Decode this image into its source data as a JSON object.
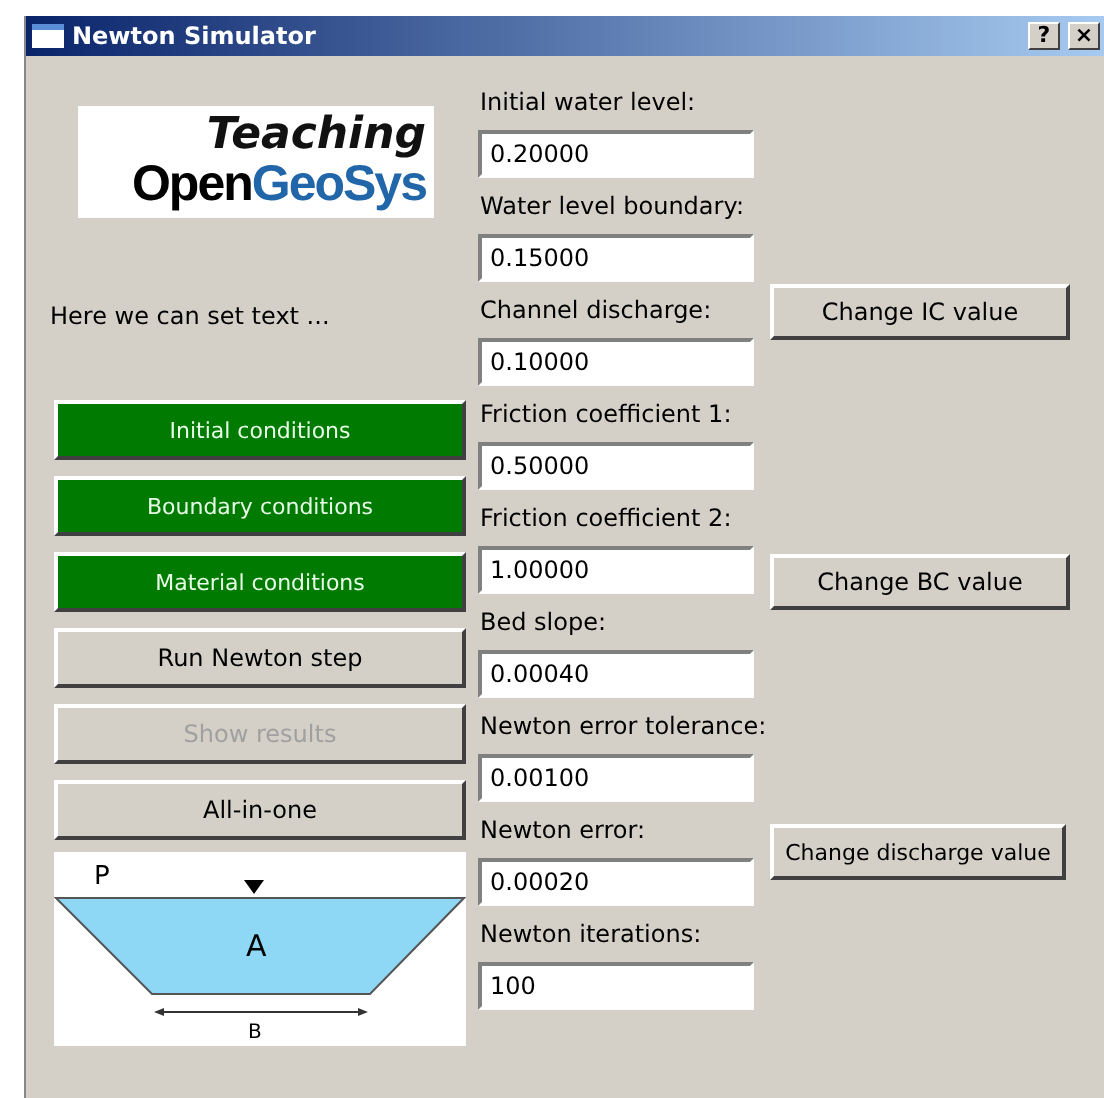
{
  "window": {
    "title": "Newton Simulator",
    "help": "?",
    "close": "×"
  },
  "logo": {
    "top": "Teaching",
    "first": "Open",
    "second": "GeoSys"
  },
  "note": "Here we can set text ...",
  "buttons": [
    {
      "label": "Initial conditions",
      "kind": "green",
      "disabled": false
    },
    {
      "label": "Boundary conditions",
      "kind": "green",
      "disabled": false
    },
    {
      "label": "Material conditions",
      "kind": "green",
      "disabled": false
    },
    {
      "label": "Run Newton step",
      "kind": "plain",
      "disabled": false
    },
    {
      "label": "Show results",
      "kind": "plain",
      "disabled": true
    },
    {
      "label": "All-in-one",
      "kind": "plain",
      "disabled": false
    }
  ],
  "diagram": {
    "perimeter": "P",
    "area": "A",
    "base": "B"
  },
  "fields": [
    {
      "label": "Initial water level:",
      "value": "0.20000"
    },
    {
      "label": "Water level boundary:",
      "value": "0.15000"
    },
    {
      "label": "Channel discharge:",
      "value": "0.10000"
    },
    {
      "label": "Friction coefficient 1:",
      "value": "0.50000"
    },
    {
      "label": "Friction coefficient 2:",
      "value": "1.00000"
    },
    {
      "label": "Bed slope:",
      "value": "0.00040"
    },
    {
      "label": "Newton error tolerance:",
      "value": "0.00100"
    },
    {
      "label": "Newton error:",
      "value": "0.00020"
    },
    {
      "label": "Newton iterations:",
      "value": "100"
    }
  ],
  "actions": [
    "Change IC value",
    "Change BC value",
    "Change discharge value"
  ]
}
